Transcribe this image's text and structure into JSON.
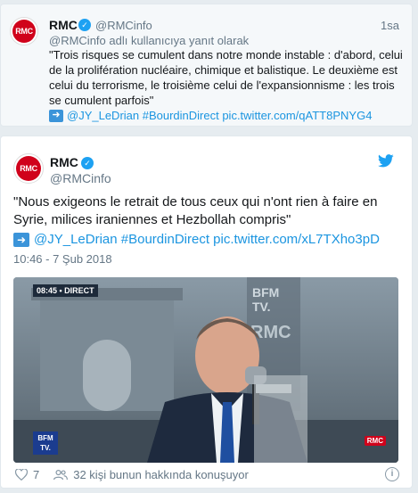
{
  "reply_tweet": {
    "avatar_text": "RMC",
    "name": "RMC",
    "handle": "@RMCinfo",
    "time": "1sa",
    "reply_to": "@RMCinfo adlı kullanıcıya yanıt olarak",
    "text_lines": [
      "\"Trois risques se cumulent dans notre monde instable : d'abord, celui",
      "de la prolifération nucléaire, chimique et balistique. Le deuxième est",
      "celui du terrorisme, le troisième celui de l'expansionnisme : les trois",
      "se cumulent parfois\""
    ],
    "link_text": "@JY_LeDrian #BourdinDirect pic.twitter.com/qATT8PNYG4"
  },
  "main_tweet": {
    "avatar_text": "RMC",
    "name": "RMC",
    "handle": "@RMCinfo",
    "text_lines": [
      "\"Nous exigeons le retrait de tous ceux qui n'ont rien à faire en",
      "Syrie, milices iraniennes et Hezbollah compris\""
    ],
    "link_text": "@JY_LeDrian #BourdinDirect pic.twitter.com/xL7TXho3pD",
    "date": "10:46 - 7 Şub 2018",
    "media": {
      "live_label": "08:45 • DIRECT",
      "bfm_logo_line1": "BFM",
      "bfm_logo_line2": "TV.",
      "rmc_badge": "RMC"
    },
    "likes": "7",
    "talking": "32 kişi bunun hakkında konuşuyor"
  },
  "colors": {
    "accent": "#1da1f2",
    "link": "#1b95e0",
    "rmc_red": "#d0021b"
  },
  "icons": [
    "verified-icon",
    "arrow-right-icon",
    "twitter-bird-icon",
    "heart-icon",
    "people-icon",
    "info-icon"
  ]
}
